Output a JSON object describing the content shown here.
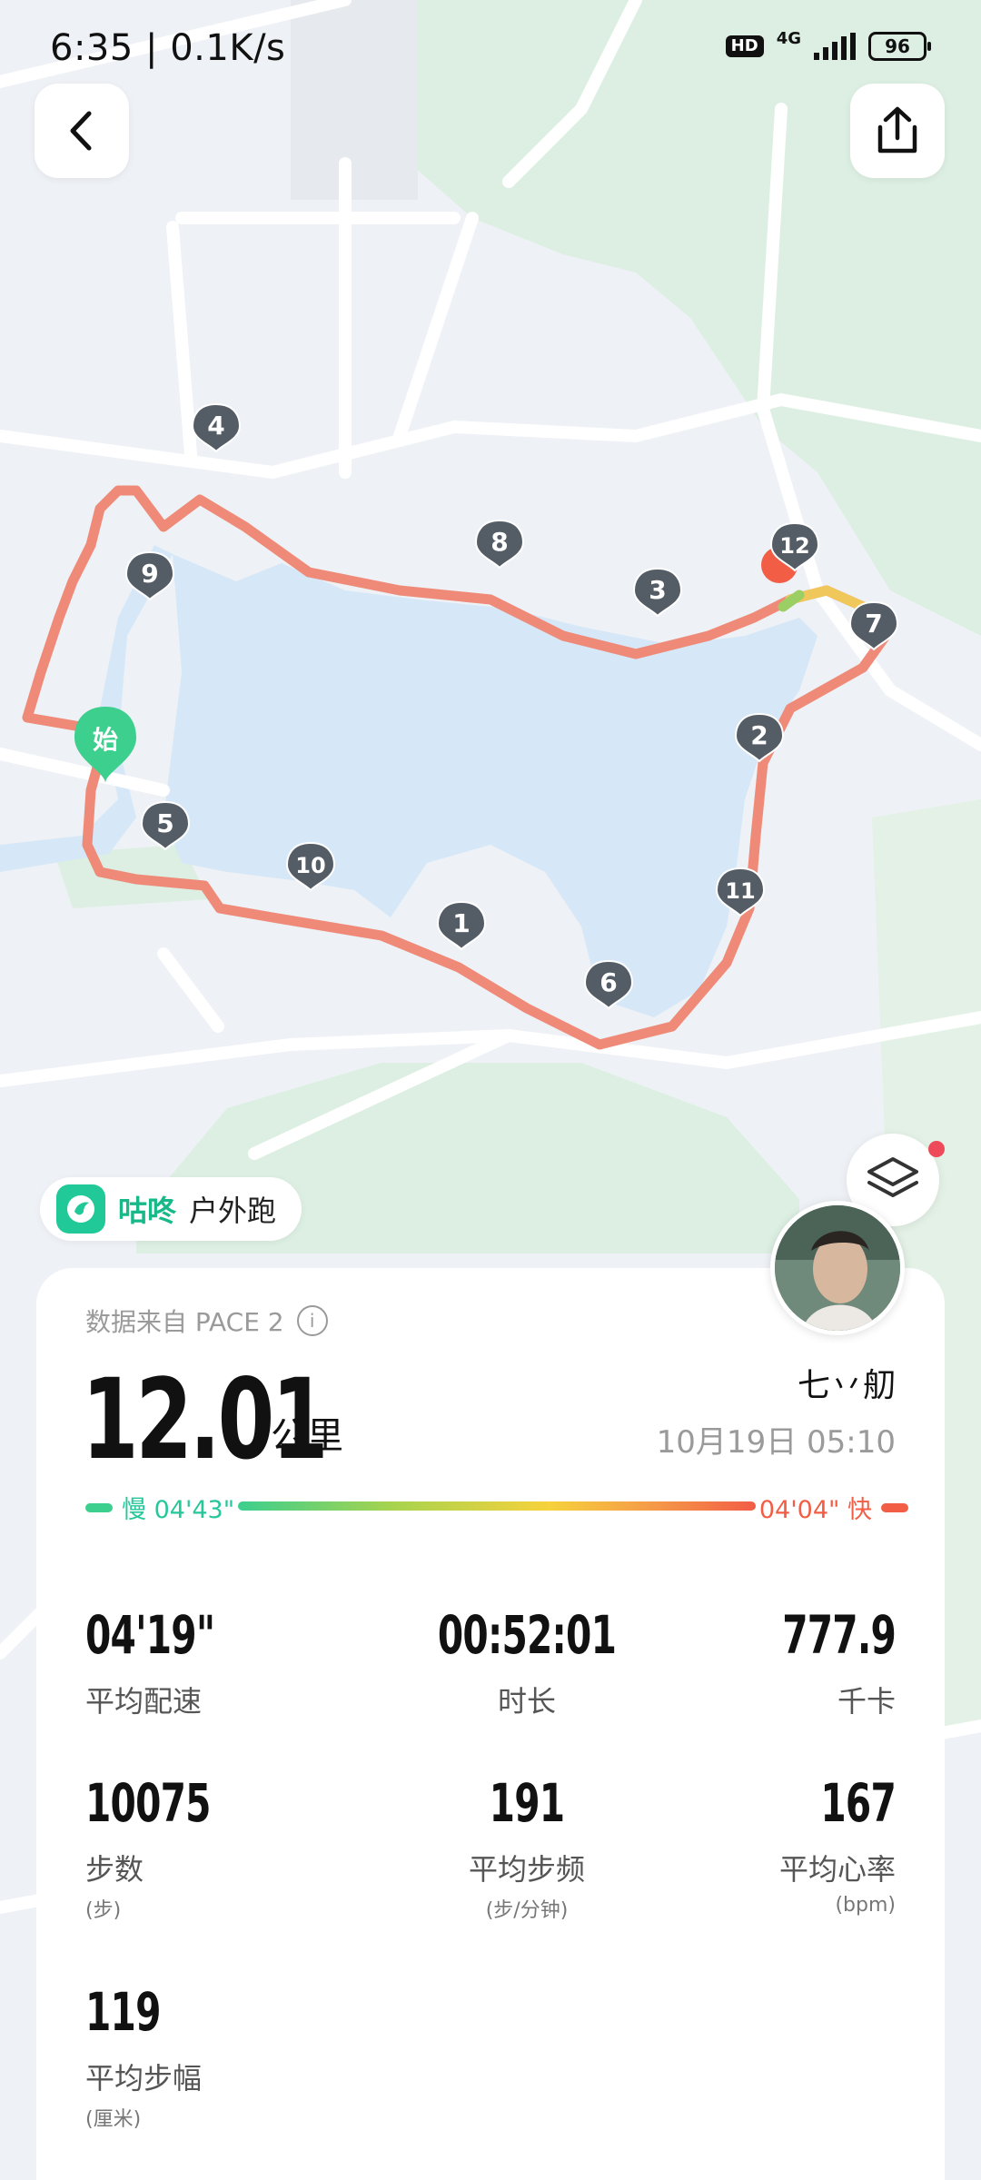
{
  "status_bar": {
    "time": "6:35 | 0.1K/s",
    "hd": "HD",
    "network": "4G",
    "battery": "96"
  },
  "map": {
    "start_label": "始",
    "km_markers": [
      "1",
      "2",
      "3",
      "4",
      "5",
      "6",
      "7",
      "8",
      "9",
      "10",
      "11",
      "12"
    ],
    "route_color": "#ef8a78",
    "water_color": "#d6e8f7",
    "green_color": "#dcefe2"
  },
  "badge": {
    "app_name": "咕咚",
    "mode": "户外跑"
  },
  "card": {
    "source": "数据来自 PACE 2",
    "distance": "12.01",
    "distance_unit": "公里",
    "username": "七丷舠",
    "datetime": "10月19日 05:10",
    "pace_slow": "慢 04'43\"",
    "pace_fast": "04'04\" 快"
  },
  "stats": [
    {
      "value": "04'19\"",
      "label": "平均配速",
      "sub": ""
    },
    {
      "value": "00:52:01",
      "label": "时长",
      "sub": ""
    },
    {
      "value": "777.9",
      "label": "千卡",
      "sub": ""
    },
    {
      "value": "10075",
      "label": "步数",
      "sub": "(步)"
    },
    {
      "value": "191",
      "label": "平均步频",
      "sub": "(步/分钟)"
    },
    {
      "value": "167",
      "label": "平均心率",
      "sub": "(bpm)"
    },
    {
      "value": "119",
      "label": "平均步幅",
      "sub": "(厘米)"
    }
  ],
  "colors": {
    "accent": "#18b889",
    "slow": "#26c79a",
    "fast": "#f25d45"
  }
}
